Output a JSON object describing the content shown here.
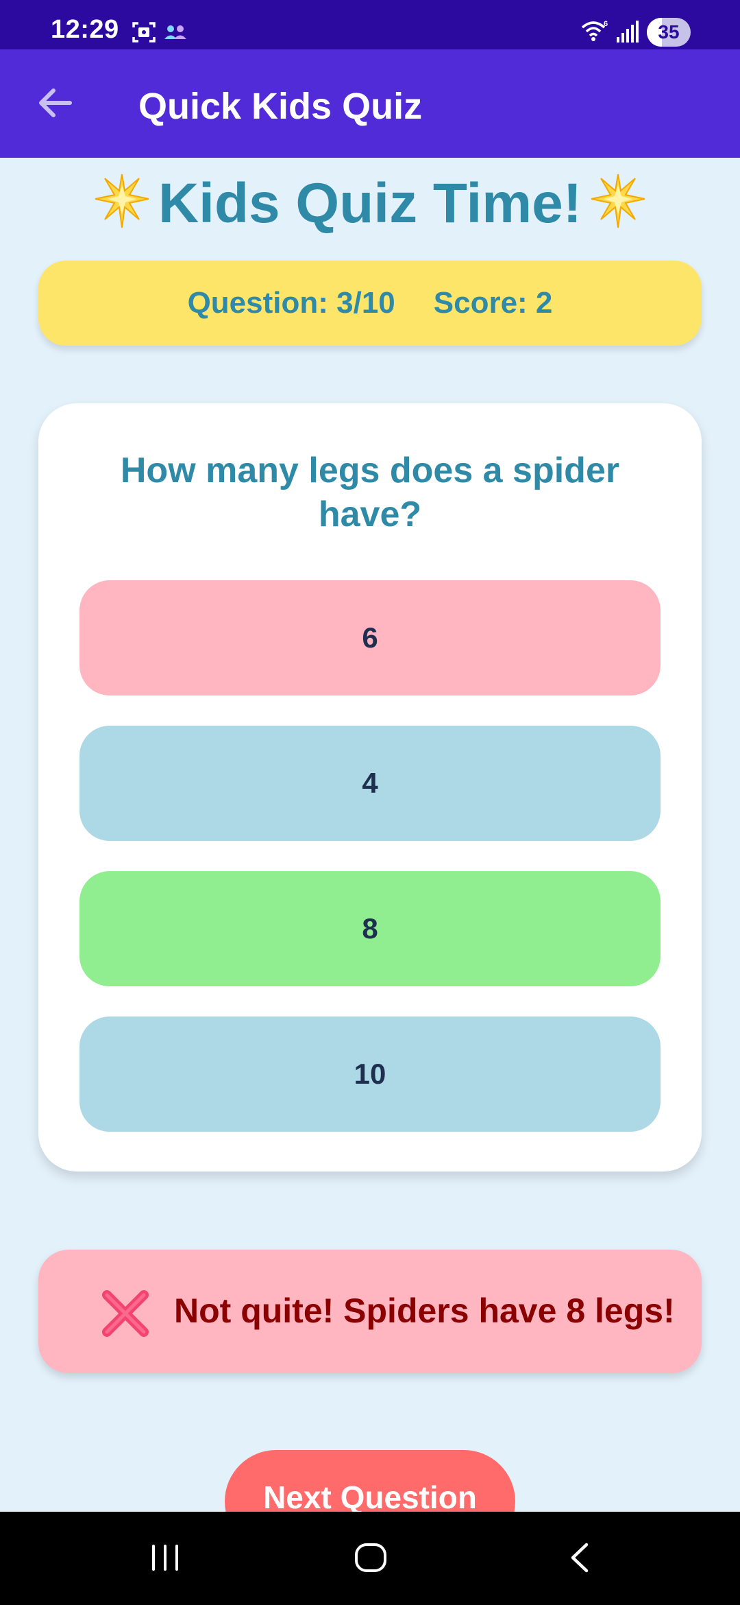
{
  "status_bar": {
    "time": "12:29",
    "battery_level": "35",
    "battery_fraction": 0.35,
    "icons": [
      "photo-capture-icon",
      "people-icon",
      "wifi-icon",
      "signal-icon",
      "battery-icon"
    ]
  },
  "app_bar": {
    "title": "Quick Kids Quiz",
    "back_icon": "arrow-left-icon"
  },
  "heading": {
    "text": "Kids Quiz Time!",
    "emoji_icon": "glowing-star-icon"
  },
  "score_banner": {
    "question": "Question: 3/10",
    "score": "Score: 2"
  },
  "question_card": {
    "question": "How many legs does a spider have?",
    "answers": [
      {
        "label": "6",
        "state": "wrong",
        "color": "#ffb6c1"
      },
      {
        "label": "4",
        "state": "neutral",
        "color": "#add8e6"
      },
      {
        "label": "8",
        "state": "correct",
        "color": "#90ee90"
      },
      {
        "label": "10",
        "state": "neutral",
        "color": "#add8e6"
      }
    ]
  },
  "feedback": {
    "icon": "cross-mark-icon",
    "text": "Not quite! Spiders have 8 legs!"
  },
  "next_button": {
    "label": "Next Question"
  },
  "colors": {
    "status_bar": "#2c0aa0",
    "app_bar": "#512bd8",
    "background": "#e3f1fb",
    "heading": "#2f8aa8",
    "banner": "#fde56a",
    "feedback_bg": "#ffb6c1",
    "feedback_text": "#8b0000",
    "next_button": "#ff6b6b"
  }
}
